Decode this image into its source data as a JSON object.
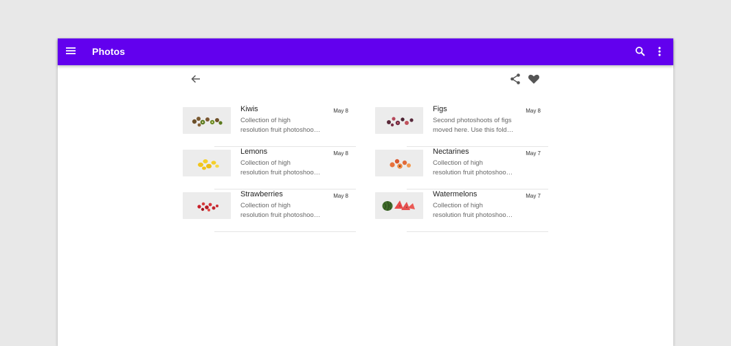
{
  "appbar": {
    "title": "Photos",
    "color": "#6200ee",
    "icons": [
      "menu-icon",
      "search-icon",
      "more-vert-icon"
    ]
  },
  "toolbar": {
    "icons": [
      "arrow-back-icon",
      "share-icon",
      "heart-icon"
    ]
  },
  "albums": [
    {
      "name": "Kiwis",
      "date": "May 8",
      "desc_line1": "Collection of high",
      "desc_line2": "resolution fruit photoshoo…"
    },
    {
      "name": "Figs",
      "date": "May 8",
      "desc_line1": "Second photoshoots of figs",
      "desc_line2": "moved here. Use this fold…"
    },
    {
      "name": "Lemons",
      "date": "May 8",
      "desc_line1": "Collection of high",
      "desc_line2": "resolution fruit photoshoo…"
    },
    {
      "name": "Nectarines",
      "date": "May 7",
      "desc_line1": "Collection of high",
      "desc_line2": "resolution fruit photoshoo…"
    },
    {
      "name": "Strawberries",
      "date": "May 8",
      "desc_line1": "Collection of high",
      "desc_line2": "resolution fruit photoshoo…"
    },
    {
      "name": "Watermelons",
      "date": "May 7",
      "desc_line1": "Collection of high",
      "desc_line2": "resolution fruit photoshoo…"
    }
  ]
}
